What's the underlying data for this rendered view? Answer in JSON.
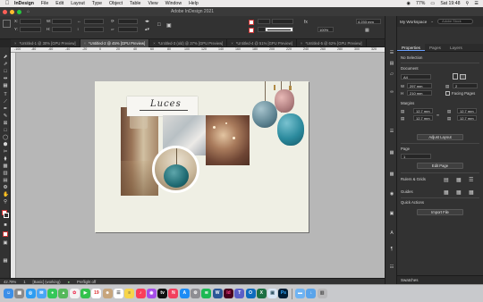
{
  "menubar": {
    "app": "InDesign",
    "items": [
      "File",
      "Edit",
      "Layout",
      "Type",
      "Object",
      "Table",
      "View",
      "Window",
      "Help"
    ],
    "battery": "77%",
    "clock": "Sat 19:48"
  },
  "window": {
    "title": "Adobe InDesign 2021"
  },
  "control": {
    "x_value": "",
    "y_value": "",
    "zoom_pct": "100%",
    "stroke_value": "4.233 mm",
    "percent": "100%"
  },
  "tabs": [
    "*Untitled-1 @ 30% [GPU Preview]",
    "*Untitled-2 @ 45% [GPU Preview]",
    "*Untitled-3 (old) @ 37% [GPU Preview]",
    "*Untitled-4 @ 51% [GPU Preview]",
    "*Untitled-5 @ 62% [GPU Preview]"
  ],
  "ruler": {
    "h_ticks": [
      "-100",
      "-80",
      "-60",
      "-40",
      "-20",
      "0",
      "20",
      "40",
      "60",
      "80",
      "100",
      "120",
      "140",
      "160",
      "180",
      "200",
      "220",
      "240",
      "260",
      "280",
      "300",
      "320"
    ]
  },
  "page": {
    "title_script": "Luces"
  },
  "status": {
    "zoom": "42.79%",
    "page_num": "1",
    "style": "[Basic] (working)",
    "preflight": "Preflight off"
  },
  "panel": {
    "workspace": "My Workspace",
    "search_placeholder": "Adobe Stock",
    "tabs": [
      "Properties",
      "Pages",
      "Layers"
    ],
    "no_selection": "No Selection",
    "section_document": "Document",
    "page_size": "A4",
    "width_label": "W",
    "width": "297 mm",
    "height_label": "H",
    "height": "210 mm",
    "pages_count": "2",
    "facing_pages": "Facing Pages",
    "section_margins": "Margins",
    "margin_top": "12.7 mm",
    "margin_bottom": "12.7 mm",
    "margin_left": "12.7 mm",
    "margin_right": "12.7 mm",
    "adjust_layout": "Adjust Layout",
    "section_page": "Page",
    "page_value": "1",
    "edit_page": "Edit Page",
    "section_rulers": "Rulers & Grids",
    "section_guides": "Guides",
    "section_quick": "Quick Actions",
    "import_file": "Import File",
    "swatches": "Swatches"
  },
  "dock": {
    "apps": [
      "Finder",
      "Launchpad",
      "Safari",
      "Mail",
      "Messages",
      "Maps",
      "Photos",
      "FaceTime",
      "Calendar",
      "Contacts",
      "Reminders",
      "Notes",
      "Music",
      "Podcasts",
      "TV",
      "News",
      "App Store",
      "System Preferences",
      "Spotify",
      "Word",
      "InDesign",
      "Teams",
      "Outlook",
      "Excel",
      "Preview",
      "Photoshop",
      "Folder",
      "Downloads",
      "Trash"
    ]
  },
  "colors": {
    "accent": "#3f7fe0",
    "panel_bg": "#323232",
    "pasteboard": "#b7b7b7",
    "page": "#efefe4"
  }
}
